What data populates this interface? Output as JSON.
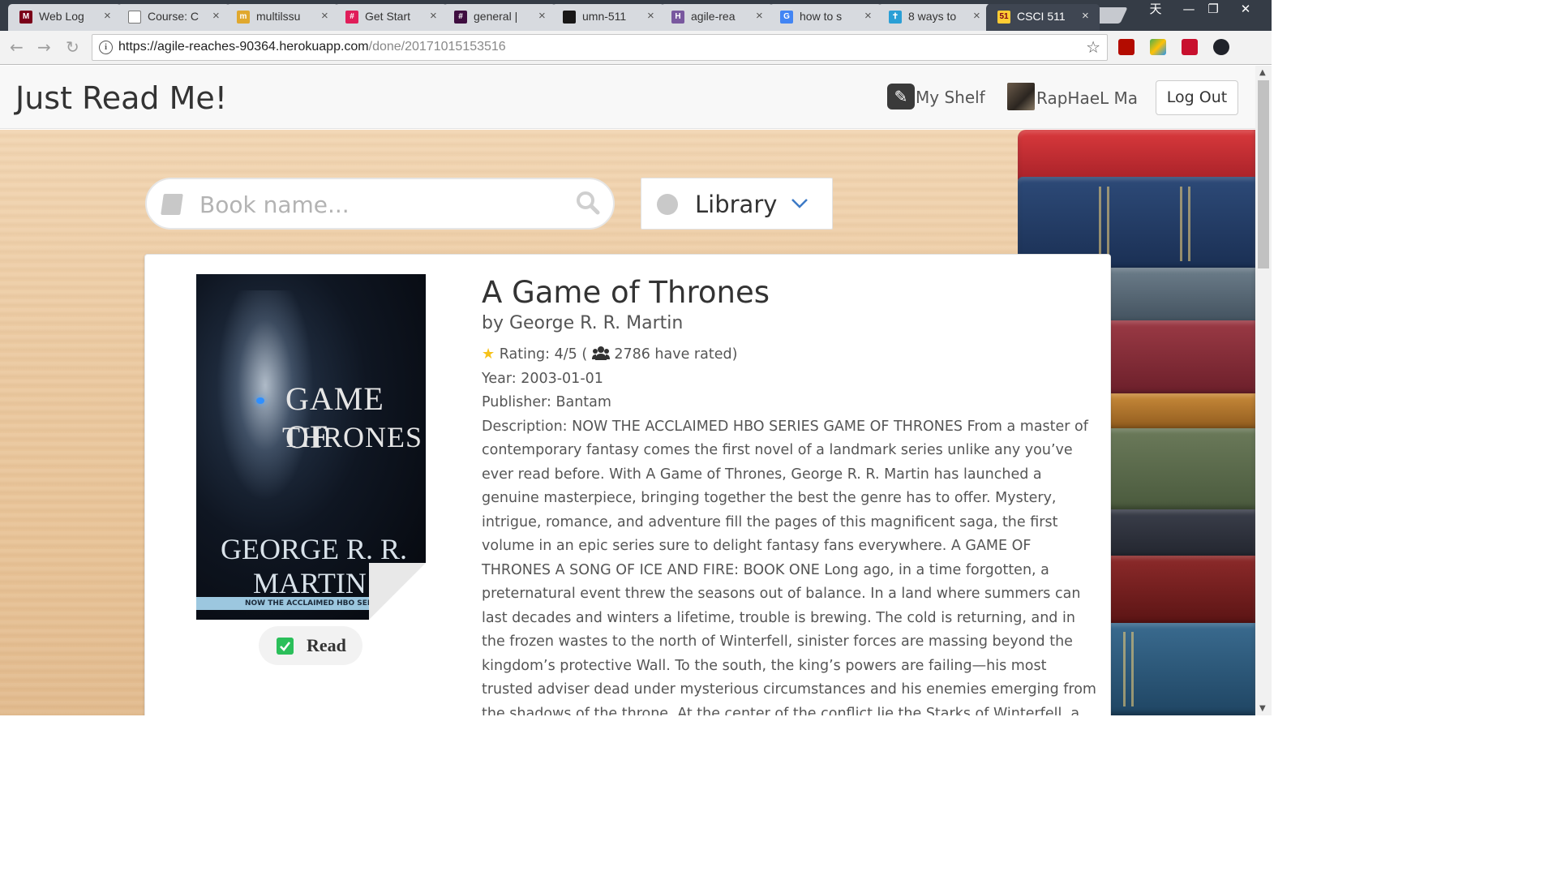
{
  "browser": {
    "tabs": [
      {
        "title": "Web Log",
        "fav_color": "#7a0019",
        "fav_glyph": "M"
      },
      {
        "title": "Course: C",
        "fav_color": "#ffffff",
        "fav_glyph": ""
      },
      {
        "title": "multilssu",
        "fav_color": "#e0a82e",
        "fav_glyph": "m"
      },
      {
        "title": "Get Start",
        "fav_color": "#e01e5a",
        "fav_glyph": "#"
      },
      {
        "title": "general |",
        "fav_color": "#3f0e40",
        "fav_glyph": "#"
      },
      {
        "title": "umn-511",
        "fav_color": "#181717",
        "fav_glyph": ""
      },
      {
        "title": "agile-rea",
        "fav_color": "#79589f",
        "fav_glyph": "H"
      },
      {
        "title": "how to s",
        "fav_color": "#4285f4",
        "fav_glyph": "G"
      },
      {
        "title": "8 ways to",
        "fav_color": "#2a9fd6",
        "fav_glyph": "✝"
      },
      {
        "title": "CSCI 511",
        "fav_color": "#ffcc33",
        "fav_glyph": "51"
      }
    ],
    "window_controls": {
      "ime": "天",
      "minimize": "—",
      "restore": "❐",
      "close": "✕"
    },
    "url_host": "https://agile-reaches-90364.herokuapp.com",
    "url_path": "/done/20171015153516"
  },
  "header": {
    "brand": "Just Read Me!",
    "my_shelf": "My Shelf",
    "user_name": "RapHaeL Ma",
    "logout": "Log Out"
  },
  "search": {
    "placeholder": "Book name...",
    "source_selected": "Library"
  },
  "book": {
    "title": "A Game of Thrones",
    "author_line": "by George R. R. Martin",
    "rating_text": "Rating: 4/5 (",
    "raters_text": "2786 have rated)",
    "year": "Year: 2003-01-01",
    "publisher": "Publisher: Bantam",
    "description": "Description: NOW THE ACCLAIMED HBO SERIES GAME OF THRONES From a master of contemporary fantasy comes the first novel of a landmark series unlike any you’ve ever read before. With A Game of Thrones, George R. R. Martin has launched a genuine masterpiece, bringing together the best the genre has to offer. Mystery, intrigue, romance, and adventure fill the pages of this magnificent saga, the first volume in an epic series sure to delight fantasy fans everywhere. A GAME OF THRONES A SONG OF ICE AND FIRE: BOOK ONE Long ago, in a time forgotten, a preternatural event threw the seasons out of balance. In a land where summers can last decades and winters a lifetime, trouble is brewing. The cold is returning, and in the frozen wastes to the north of Winterfell, sinister forces are massing beyond the kingdom’s protective Wall. To the south, the king’s powers are failing—his most trusted adviser dead under mysterious circumstances and his enemies emerging from the shadows of the throne. At the center of the conflict lie the Starks of Winterfell, a family as harsh and unyielding as the",
    "cover": {
      "title_line1": "GAME OF",
      "title_line2": "THRONES",
      "author_line1": "GEORGE R. R.",
      "author_line2": "MARTIN",
      "band_text": "NOW THE ACCLAIMED HBO SERIES"
    },
    "read_button": "Read"
  },
  "colors": {
    "read_check": "#2bbf5a",
    "star": "#f6c21a"
  }
}
